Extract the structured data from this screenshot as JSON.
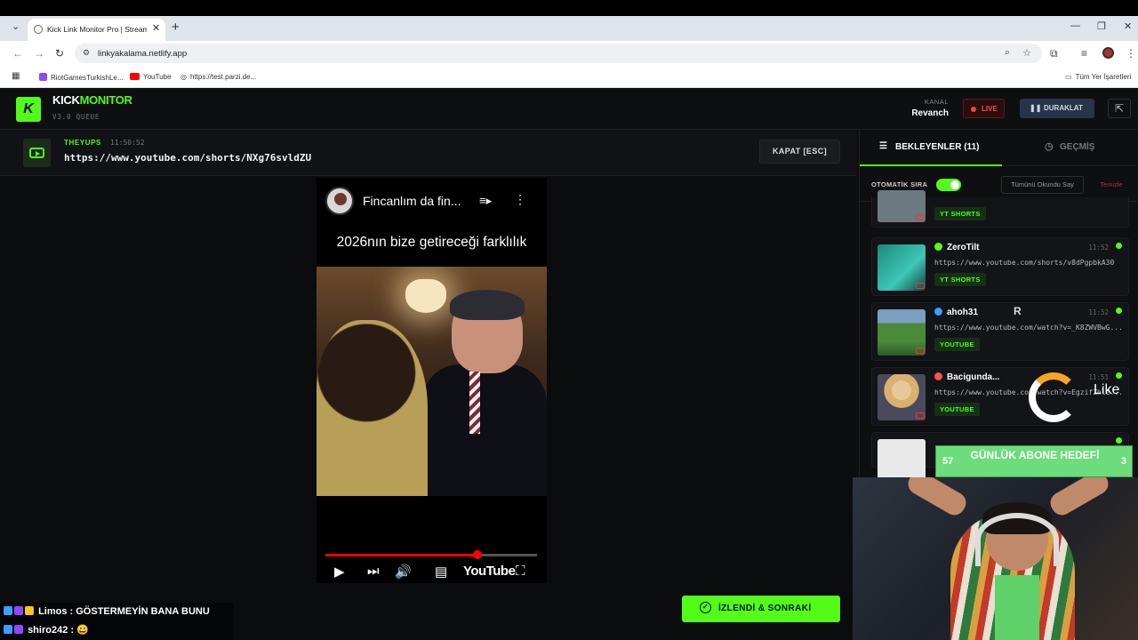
{
  "browser": {
    "tab_title": "Kick Link Monitor Pro | Stream",
    "url": "linkyakalama.netlify.app",
    "bookmarks": [
      "RiotGamesTurkishLe...",
      "YouTube",
      "https://test.parzi.de..."
    ],
    "all_bookmarks": "Tüm Yer İşaretleri"
  },
  "header": {
    "logo_letter": "K",
    "brand_a": "KICK",
    "brand_b": "MONITOR",
    "version": "V3.0 QUEUE",
    "kanal_label": "KANAL",
    "kanal_name": "Revanch",
    "live_label": "LIVE",
    "pause_label": "DURAKLAT"
  },
  "current": {
    "user": "THEYUPS",
    "time": "11:50:52",
    "url": "https://www.youtube.com/shorts/NXg76svldZU",
    "close_label": "KAPAT [ESC]"
  },
  "player": {
    "title": "Fincanlım da fin...",
    "caption": "2026nın bize getireceği farklılık",
    "youtube_label": "YouTube",
    "progress": 0.72
  },
  "watch_button": "İZLENDİ & SONRAKİ",
  "sidebar": {
    "tab_waiting": "BEKLEYENLER (11)",
    "tab_history": "GEÇMİŞ",
    "auto_label": "OTOMATİK SIRA",
    "mark_read": "Tümünü Okundu Say",
    "clear": "Temizle",
    "queue": [
      {
        "name": "",
        "time": "",
        "url": "",
        "tag": "YT SHORTS",
        "badge_color": "#53fc18"
      },
      {
        "name": "ZeroTilt",
        "time": "11:52",
        "url": "https://www.youtube.com/shorts/v8dPgpbkA30",
        "tag": "YT SHORTS",
        "badge_color": "#53fc18"
      },
      {
        "name": "ahoh31",
        "time": "11:52",
        "url": "https://www.youtube.com/watch?v=_K8ZWVBwG...",
        "tag": "YOUTUBE",
        "badge_color": "#3aa0ff"
      },
      {
        "name": "Bacigunda...",
        "time": "11:51",
        "url": "https://www.youtube.com/watch?v=EgzifZhlI...",
        "tag": "YOUTUBE",
        "badge_color": "#ff5050"
      }
    ]
  },
  "overlay": {
    "goal_label": "GÜNLÜK ABONE HEDEFİ",
    "goal_current": "57",
    "goal_right": "3",
    "like_text": "Like",
    "r_mark": "R"
  },
  "chat": [
    {
      "user": "Limos",
      "message": ": GÖSTERMEYİN BANA BUNU"
    },
    {
      "user": "shiro242",
      "message": ": 😀"
    }
  ],
  "colors": {
    "accent": "#53fc18",
    "live": "#ff4040",
    "bg": "#0e0f11"
  }
}
